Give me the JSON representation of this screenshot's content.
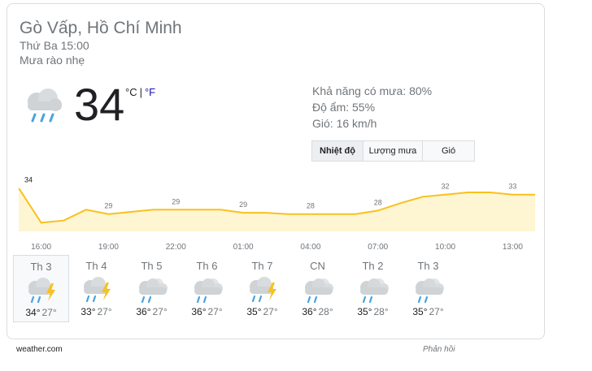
{
  "header": {
    "location": "Gò Vấp, Hồ Chí Minh",
    "daytime": "Thứ Ba 15:00",
    "condition": "Mưa rào nhẹ"
  },
  "current": {
    "temperature": "34",
    "unit_c": "°C",
    "separator": "|",
    "unit_f": "°F",
    "icon": "rain-cloud-icon"
  },
  "details": {
    "precip": "Khả năng có mưa: 80%",
    "humidity": "Độ ẩm: 55%",
    "wind": "Gió: 16 km/h"
  },
  "tabs": [
    {
      "label": "Nhiệt độ",
      "active": true
    },
    {
      "label": "Lượng mưa",
      "active": false
    },
    {
      "label": "Gió",
      "active": false
    }
  ],
  "chart_data": {
    "type": "area",
    "x": [
      "15:00",
      "16:00",
      "17:00",
      "18:00",
      "19:00",
      "20:00",
      "21:00",
      "22:00",
      "23:00",
      "00:00",
      "01:00",
      "02:00",
      "03:00",
      "04:00",
      "05:00",
      "06:00",
      "07:00",
      "08:00",
      "09:00",
      "10:00",
      "11:00",
      "12:00",
      "13:00",
      "14:00"
    ],
    "values": [
      34,
      26,
      26.5,
      29,
      28,
      28.5,
      29,
      29,
      29,
      29,
      28.3,
      28.3,
      28,
      28,
      28,
      28,
      28.8,
      30.5,
      32,
      32.5,
      33,
      33,
      32.5,
      32.5
    ],
    "tick_labels": [
      "16:00",
      "19:00",
      "22:00",
      "01:00",
      "04:00",
      "07:00",
      "10:00",
      "13:00"
    ],
    "value_labels": [
      {
        "x": "15:00",
        "text": "34"
      },
      {
        "x": "19:00",
        "text": "29"
      },
      {
        "x": "22:00",
        "text": "29"
      },
      {
        "x": "01:00",
        "text": "29"
      },
      {
        "x": "04:00",
        "text": "28"
      },
      {
        "x": "07:00",
        "text": "28"
      },
      {
        "x": "10:00",
        "text": "32"
      },
      {
        "x": "13:00",
        "text": "33"
      }
    ],
    "line_color": "#f9c11c",
    "fill_color": "#fef5d3",
    "ylim": [
      24,
      36
    ]
  },
  "forecast": [
    {
      "day": "Th 3",
      "icon": "thunderstorm-icon",
      "hi": "34°",
      "lo": "27°",
      "active": true
    },
    {
      "day": "Th 4",
      "icon": "thunderstorm-icon",
      "hi": "33°",
      "lo": "27°",
      "active": false
    },
    {
      "day": "Th 5",
      "icon": "rain-partly-cloudy-icon",
      "hi": "36°",
      "lo": "27°",
      "active": false
    },
    {
      "day": "Th 6",
      "icon": "rain-partly-cloudy-icon",
      "hi": "36°",
      "lo": "27°",
      "active": false
    },
    {
      "day": "Th 7",
      "icon": "thunderstorm-icon",
      "hi": "35°",
      "lo": "27°",
      "active": false
    },
    {
      "day": "CN",
      "icon": "rain-partly-cloudy-icon",
      "hi": "36°",
      "lo": "28°",
      "active": false
    },
    {
      "day": "Th 2",
      "icon": "rain-partly-cloudy-icon",
      "hi": "35°",
      "lo": "28°",
      "active": false
    },
    {
      "day": "Th 3",
      "icon": "rain-partly-cloudy-icon",
      "hi": "35°",
      "lo": "27°",
      "active": false
    }
  ],
  "footer": {
    "source": "weather.com",
    "feedback": "Phản hồi"
  },
  "colors": {
    "accent_link": "#1a0dab",
    "muted_text": "#70757a",
    "rain_drop": "#4aa3df",
    "cloud": "#cfd3d6",
    "bolt": "#f9c11c"
  }
}
